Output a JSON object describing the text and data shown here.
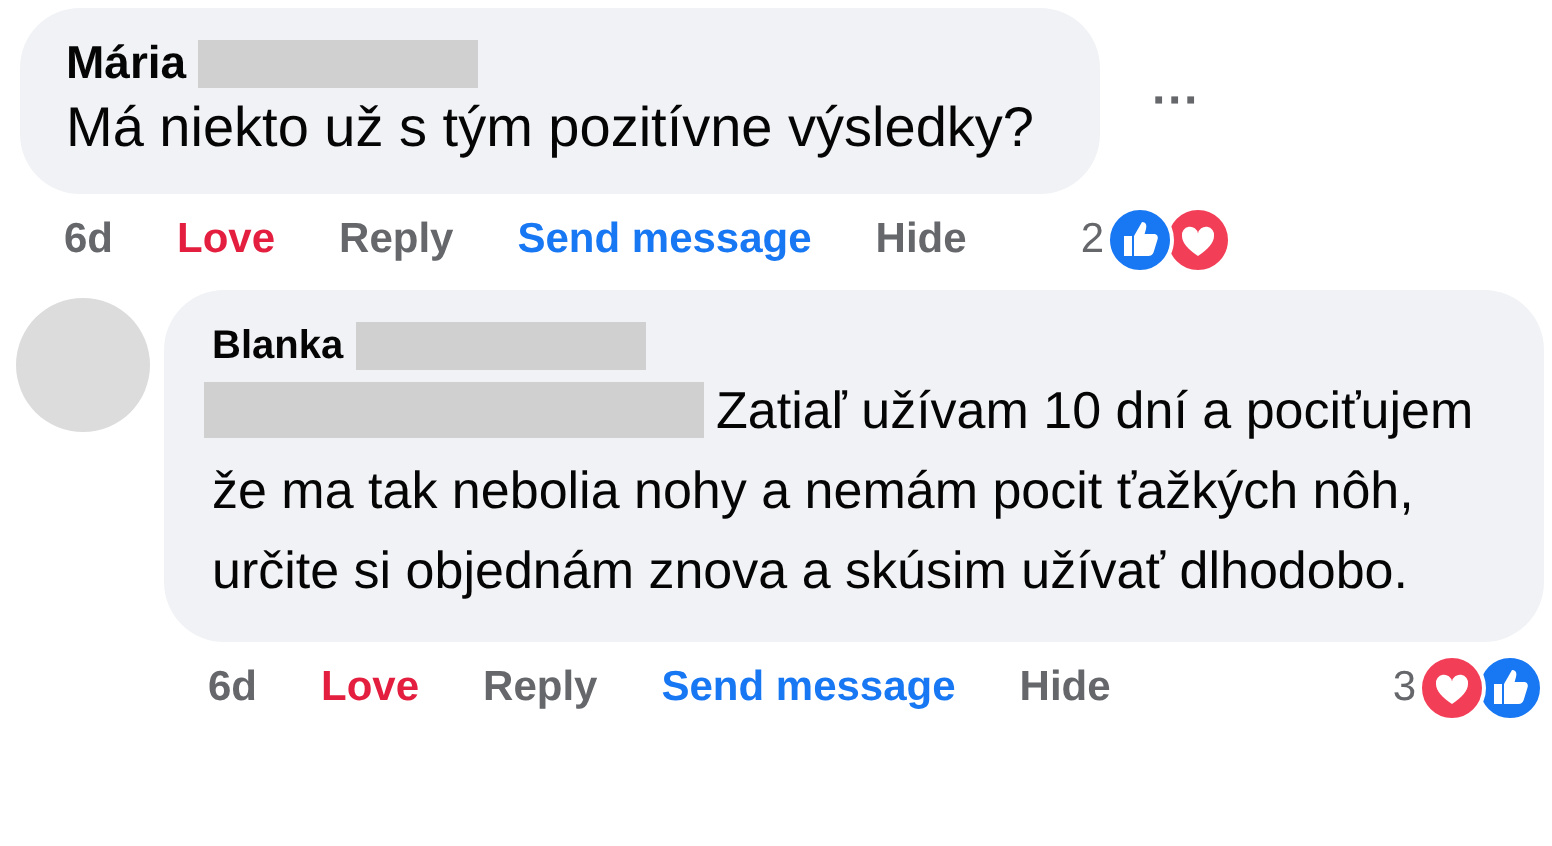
{
  "comments": [
    {
      "author": "Mária",
      "mention_redacted": false,
      "text": "Má niekto už s tým pozitívne výsledky?",
      "avatar": false,
      "menu": "···",
      "actions": [
        {
          "label": "6d",
          "kind": "time"
        },
        {
          "label": "Love",
          "kind": "reaction",
          "active": true
        },
        {
          "label": "Reply",
          "kind": "reply"
        },
        {
          "label": "Send message",
          "kind": "link"
        },
        {
          "label": "Hide",
          "kind": "hide"
        }
      ],
      "reaction_count": "2",
      "reactions": [
        {
          "kind": "like"
        },
        {
          "kind": "love"
        }
      ]
    },
    {
      "author": "Blanka",
      "mention_redacted": true,
      "text": "Zatiaľ užívam 10 dní a pociťujem že ma tak nebolia nohy a nemám pocit ťažkých nôh, určite si objednám znova a skúsim užívať dlhodobo.",
      "avatar": true,
      "actions": [
        {
          "label": "6d",
          "kind": "time"
        },
        {
          "label": "Love",
          "kind": "reaction",
          "active": true
        },
        {
          "label": "Reply",
          "kind": "reply"
        },
        {
          "label": "Send message",
          "kind": "link"
        },
        {
          "label": "Hide",
          "kind": "hide"
        }
      ],
      "reaction_count": "3",
      "reactions": [
        {
          "kind": "love"
        },
        {
          "kind": "like"
        }
      ]
    }
  ]
}
